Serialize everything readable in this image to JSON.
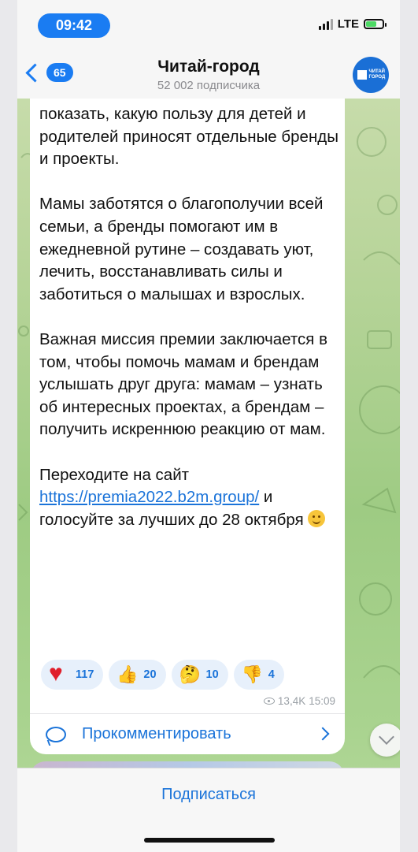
{
  "status_bar": {
    "time": "09:42",
    "network": "LTE"
  },
  "header": {
    "back_count": "65",
    "title": "Читай-город",
    "subtitle": "52 002 подписчика",
    "avatar_text": "ЧИТАЙ ГОРОД"
  },
  "message": {
    "text_before_link": "показать, какую пользу для детей и родителей приносят отдельные бренды и проекты.\n\nМамы заботятся о благополучии всей семьи, а бренды помогают им в ежедневной рутине – создавать уют, лечить, восстанавливать силы и заботиться о малышах и взрослых.\n\nВажная миссия премии заключается в том, чтобы помочь мамам и брендам услышать друг друга: мамам – узнать об интересных проектах, а брендам – получить искреннюю реакцию от мам.\n\nПереходите на сайт ",
    "link": "https://premia2022.b2m.group/",
    "text_after_link": " и голосуйте за лучших до 28 октября ",
    "reactions": [
      {
        "icon": "heart-icon",
        "count": "117"
      },
      {
        "icon": "thumbs-up-icon",
        "count": "20"
      },
      {
        "icon": "thinking-face-icon",
        "count": "10"
      },
      {
        "icon": "thumbs-down-icon",
        "count": "4"
      }
    ],
    "views": "13,4K",
    "time": "15:09",
    "comment_label": "Прокомментировать"
  },
  "bottom": {
    "subscribe_label": "Подписаться"
  },
  "colors": {
    "accent": "#1a73d9",
    "heart": "#e01f2b",
    "pill": "#1a7cf2"
  }
}
